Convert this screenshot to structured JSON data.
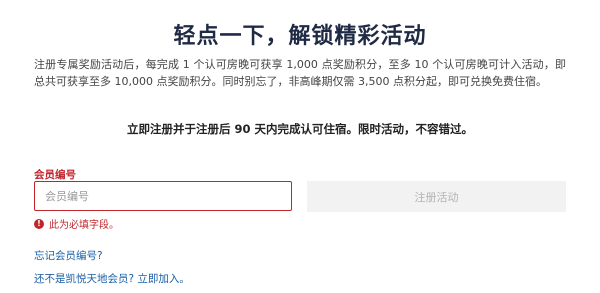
{
  "header": {
    "title": "轻点一下，解锁精彩活动"
  },
  "promo": {
    "description": "注册专属奖励活动后，每完成 1 个认可房晚可获享 1,000 点奖励积分，至多 10 个认可房晚可计入活动，即总共可获享至多 10,000 点奖励积分。同时别忘了，非高峰期仅需 3,500 点积分起，即可兑换免费住宿。",
    "cta_note": "立即注册并于注册后 90 天内完成认可住宿。限时活动，不容错过。"
  },
  "form": {
    "member_label": "会员编号",
    "member_placeholder": "会员编号",
    "member_value": "",
    "register_label": "注册活动",
    "error_text": "此为必填字段。",
    "error_icon": "error-icon"
  },
  "links": {
    "forgot_member_number": "忘记会员编号?",
    "not_member_text": "还不是凯悦天地会员?",
    "join_now": "立即加入。"
  },
  "colors": {
    "title": "#1f2a44",
    "error": "#c0272d",
    "link": "#1a5fa8",
    "button_bg": "#f2f2f2",
    "button_text": "#b3b3b3"
  }
}
